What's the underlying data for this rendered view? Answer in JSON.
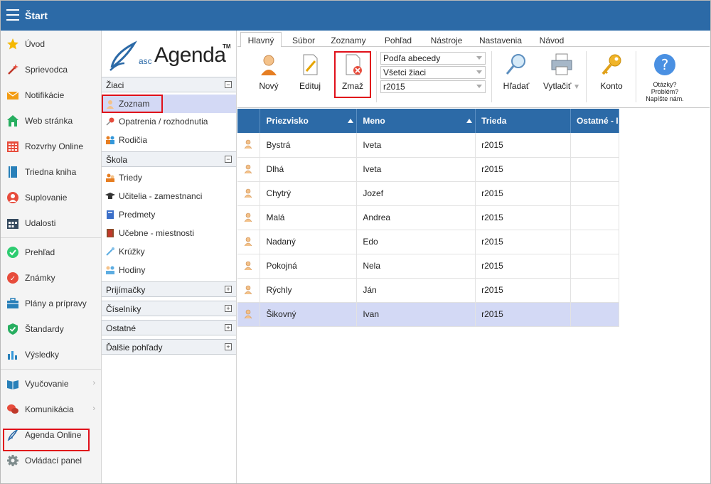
{
  "app": {
    "title": "Štart"
  },
  "leftnav": {
    "group1": [
      {
        "label": "Úvod",
        "icon": "star-icon"
      },
      {
        "label": "Sprievodca",
        "icon": "magic-wand-icon"
      },
      {
        "label": "Notifikácie",
        "icon": "envelope-icon"
      },
      {
        "label": "Web stránka",
        "icon": "house-icon"
      },
      {
        "label": "Rozvrhy Online",
        "icon": "calendar-grid-icon"
      },
      {
        "label": "Triedna kniha",
        "icon": "book-icon"
      },
      {
        "label": "Suplovanie",
        "icon": "substitute-icon"
      },
      {
        "label": "Udalosti",
        "icon": "calendar-icon"
      }
    ],
    "group2": [
      {
        "label": "Prehľad",
        "icon": "check-circle-icon"
      },
      {
        "label": "Známky",
        "icon": "grade-icon"
      },
      {
        "label": "Plány a prípravy",
        "icon": "briefcase-icon"
      },
      {
        "label": "Štandardy",
        "icon": "shield-check-icon"
      },
      {
        "label": "Výsledky",
        "icon": "bar-chart-icon"
      }
    ],
    "group3": [
      {
        "label": "Vyučovanie",
        "icon": "open-book-icon"
      },
      {
        "label": "Komunikácia",
        "icon": "chat-icon"
      },
      {
        "label": "Agenda Online",
        "icon": "pen-icon"
      },
      {
        "label": "Ovládací panel",
        "icon": "gear-icon"
      }
    ]
  },
  "midpanel": {
    "logo": {
      "small": "asc",
      "big": "Agenda",
      "tm": "TM"
    },
    "sections": {
      "ziaci": {
        "label": "Žiaci",
        "toggle": "−"
      },
      "skola": {
        "label": "Škola",
        "toggle": "−"
      },
      "prijimacky": {
        "label": "Prijímačky",
        "toggle": "+"
      },
      "ciselniky": {
        "label": "Číselníky",
        "toggle": "+"
      },
      "ostatne": {
        "label": "Ostatné",
        "toggle": "+"
      },
      "dalsie": {
        "label": "Ďalšie pohľady",
        "toggle": "+"
      }
    },
    "ziaci_items": [
      "Zoznam",
      "Opatrenia / rozhodnutia",
      "Rodičia"
    ],
    "skola_items": [
      "Triedy",
      "Učitelia - zamestnanci",
      "Predmety",
      "Učebne - miestnosti",
      "Krúžky",
      "Hodiny"
    ]
  },
  "tabs": [
    "Hlavný",
    "Súbor",
    "Zoznamy",
    "Pohľad",
    "Nástroje",
    "Nastavenia",
    "Návod"
  ],
  "ribbon": {
    "novy": "Nový",
    "edituj": "Edituj",
    "zmaz": "Zmaž",
    "combos": [
      "Podľa abecedy",
      "Všetci žiaci",
      "r2015"
    ],
    "hladat": "Hľadať",
    "vytlacit": "Vytlačiť",
    "konto": "Konto",
    "help": [
      "Otázky?",
      "Problém?",
      "Napíšte nám."
    ]
  },
  "table": {
    "headers": [
      "Priezvisko",
      "Meno",
      "Trieda",
      "Ostatné - I"
    ],
    "rows": [
      [
        "Bystrá",
        "Iveta",
        "r2015"
      ],
      [
        "Dlhá",
        "Iveta",
        "r2015"
      ],
      [
        "Chytrý",
        "Jozef",
        "r2015"
      ],
      [
        "Malá",
        "Andrea",
        "r2015"
      ],
      [
        "Nadaný",
        "Edo",
        "r2015"
      ],
      [
        "Pokojná",
        "Nela",
        "r2015"
      ],
      [
        "Rýchly",
        "Ján",
        "r2015"
      ],
      [
        "Šikovný",
        "Ivan",
        "r2015"
      ]
    ],
    "selected_row": 7
  },
  "colors": {
    "accent": "#2c6aa7",
    "highlight": "#d3d9f5",
    "red_box": "#e0101a"
  }
}
